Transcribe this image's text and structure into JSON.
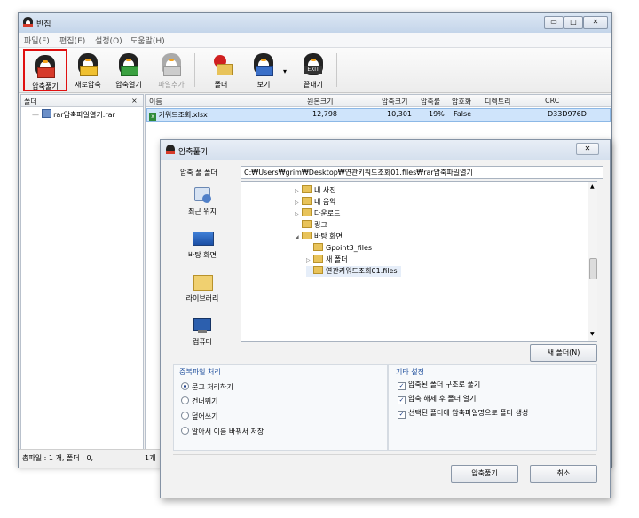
{
  "app": {
    "title": "반집"
  },
  "window_buttons": {
    "minimize": "▭",
    "maximize": "□",
    "close": "✕"
  },
  "menu": [
    "파일(F)",
    "편집(E)",
    "설정(O)",
    "도움말(H)"
  ],
  "toolbar": [
    {
      "label": "압축풀기",
      "icon": "extract-icon",
      "selected": true
    },
    {
      "label": "새로압축",
      "icon": "new-archive-icon"
    },
    {
      "label": "압축열기",
      "icon": "open-archive-icon"
    },
    {
      "label": "파일추가",
      "icon": "add-file-icon",
      "disabled": true
    },
    {
      "label": "폴더",
      "icon": "folder-icon"
    },
    {
      "label": "보기",
      "icon": "view-icon"
    },
    {
      "label": "끝내기",
      "icon": "exit-icon"
    }
  ],
  "left_pane": {
    "header": "폴더",
    "close": "×",
    "item": "rar압축파일열기.rar"
  },
  "columns": {
    "name": "이름",
    "orig": "원본크기",
    "comp": "압축크기",
    "rate": "압축률",
    "enc": "암호화",
    "dir": "디렉토리",
    "crc": "CRC"
  },
  "file_row": {
    "name": "키워드조회.xlsx",
    "orig": "12,798",
    "comp": "10,301",
    "rate": "19%",
    "enc": "False",
    "crc": "D33D976D"
  },
  "status": {
    "left": "총파일 : 1 개, 폴더 : 0,",
    "right": "1개"
  },
  "dialog": {
    "title": "압축풀기",
    "close": "✕",
    "path_label": "압축 풀 폴더",
    "path_value": "C:₩Users₩grim₩Desktop₩연관키워드조회01.files₩rar압축파일열기",
    "places": [
      "최근 위치",
      "바탕 화면",
      "라이브러리",
      "컴퓨터"
    ],
    "tree": [
      {
        "label": "내 사진",
        "indent": 0,
        "expander": "▷"
      },
      {
        "label": "내 음악",
        "indent": 0,
        "expander": "▷"
      },
      {
        "label": "다운로드",
        "indent": 0,
        "expander": "▷"
      },
      {
        "label": "링크",
        "indent": 0,
        "expander": ""
      },
      {
        "label": "바탕 화면",
        "indent": 0,
        "expander": "◢"
      },
      {
        "label": "Gpoint3_files",
        "indent": 1,
        "expander": ""
      },
      {
        "label": "새 폴더",
        "indent": 1,
        "expander": "▷"
      },
      {
        "label": "연관키워드조회01.files",
        "indent": 1,
        "expander": "",
        "selected": true
      }
    ],
    "new_folder_button": "새 폴더(N)",
    "dup_group": {
      "title": "중복파일 처리",
      "options": [
        "묻고 처리하기",
        "건너뛰기",
        "덮어쓰기",
        "알아서 이름 바꿔서 저장"
      ],
      "selected": 0
    },
    "etc_group": {
      "title": "기타 설정",
      "options": [
        "압축된 폴더 구조로 풀기",
        "압축 해제 후 폴더 열기",
        "선택된 폴더에 압축파일명으로 폴더 생성"
      ]
    },
    "ok_button": "압축풀기",
    "cancel_button": "취소"
  }
}
